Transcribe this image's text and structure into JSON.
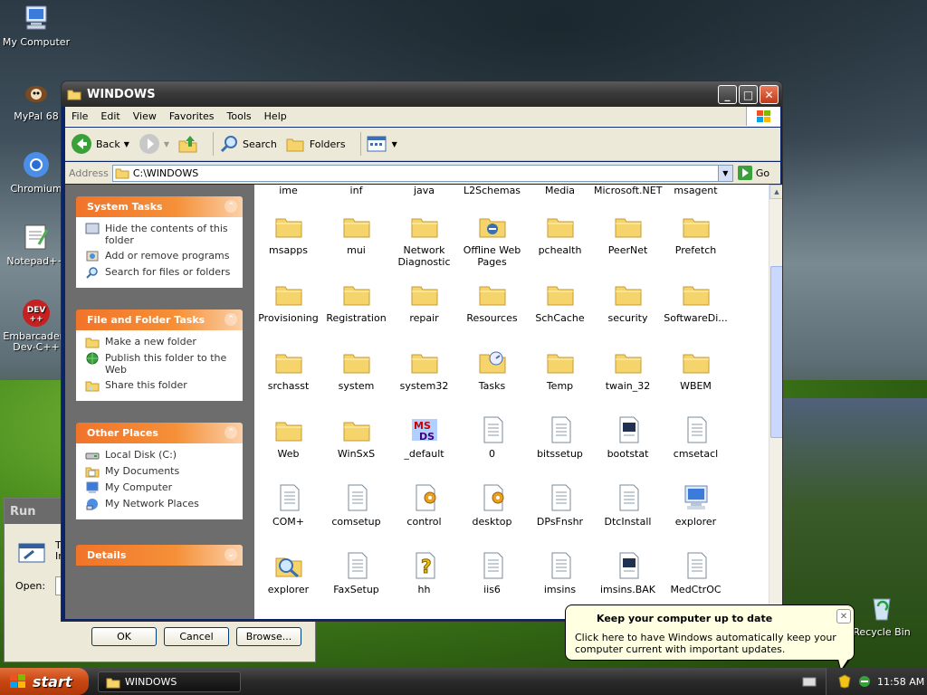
{
  "desktop": {
    "icons": [
      {
        "label": "My Computer",
        "icon": "my-computer-icon"
      },
      {
        "label": "MyPal 68",
        "icon": "mypal-icon"
      },
      {
        "label": "Chromium",
        "icon": "chromium-icon"
      },
      {
        "label": "Notepad++",
        "icon": "notepad-plus-plus-icon"
      },
      {
        "label": "Embarcadero Dev-C++",
        "icon": "devcpp-icon"
      },
      {
        "label": "Recycle Bin",
        "icon": "recycle-bin-icon"
      }
    ]
  },
  "window": {
    "title": "WINDOWS",
    "menu": [
      "File",
      "Edit",
      "View",
      "Favorites",
      "Tools",
      "Help"
    ],
    "toolbar": {
      "back": "Back",
      "search": "Search",
      "folders": "Folders"
    },
    "address": {
      "label": "Address",
      "value": "C:\\WINDOWS",
      "go": "Go"
    }
  },
  "left_pane": {
    "system_tasks": {
      "title": "System Tasks",
      "items": [
        "Hide the contents of this folder",
        "Add or remove programs",
        "Search for files or folders"
      ]
    },
    "file_folder_tasks": {
      "title": "File and Folder Tasks",
      "items": [
        "Make a new folder",
        "Publish this folder to the Web",
        "Share this folder"
      ]
    },
    "other_places": {
      "title": "Other Places",
      "items": [
        "Local Disk (C:)",
        "My Documents",
        "My Computer",
        "My Network Places"
      ]
    },
    "details": {
      "title": "Details"
    }
  },
  "files": {
    "row0": [
      "ime",
      "inf",
      "java",
      "L2Schemas",
      "Media",
      "Microsoft.NET",
      "msagent"
    ],
    "row1": [
      "msapps",
      "mui",
      "Network Diagnostic",
      "Offline Web Pages",
      "pchealth",
      "PeerNet",
      "Prefetch"
    ],
    "row2": [
      "Provisioning",
      "Registration",
      "repair",
      "Resources",
      "SchCache",
      "security",
      "SoftwareDi..."
    ],
    "row3": [
      "srchasst",
      "system",
      "system32",
      "Tasks",
      "Temp",
      "twain_32",
      "WBEM"
    ],
    "row4": [
      "Web",
      "WinSxS",
      "_default",
      "0",
      "bitssetup",
      "bootstat",
      "cmsetacl"
    ],
    "row5": [
      "COM+",
      "comsetup",
      "control",
      "desktop",
      "DPsFnshr",
      "DtcInstall",
      "explorer"
    ],
    "row6": [
      "explorer",
      "FaxSetup",
      "hh",
      "iis6",
      "imsins",
      "imsins.BAK",
      "MedCtrOC"
    ]
  },
  "run_dialog": {
    "title": "Run",
    "open_label": "Open:",
    "ok": "OK",
    "cancel": "Cancel",
    "browse": "Browse...",
    "text_fragment_1": "T",
    "text_fragment_2": "In"
  },
  "taskbar": {
    "start": "start",
    "task": "WINDOWS",
    "clock": "11:58 AM"
  },
  "balloon": {
    "title": "Keep your computer up to date",
    "body": "Click here to have Windows automatically keep your computer current with important updates."
  },
  "colors": {
    "task_header": "#f1742a",
    "folder": "#f5d46b",
    "title_bar": "#3a3a3a"
  }
}
